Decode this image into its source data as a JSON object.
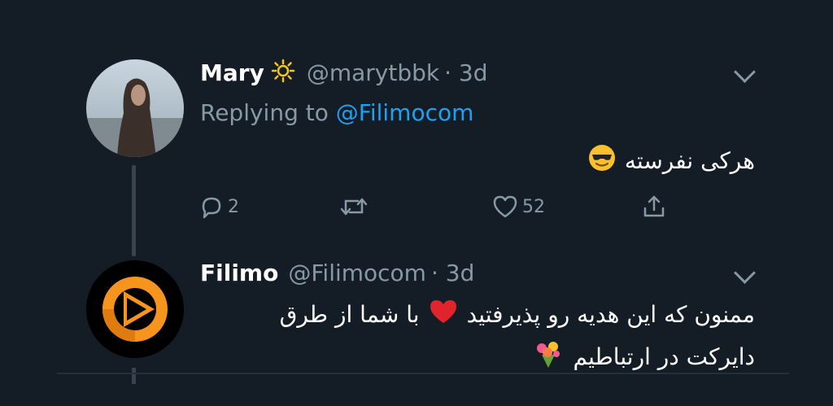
{
  "tweets": [
    {
      "name": "Mary",
      "name_emoji": "sun-icon",
      "handle": "@marytbbk",
      "time": "· 3d",
      "replying_prefix": "Replying to",
      "replying_to": "@Filimocom",
      "text": "هرکی نفرسته",
      "text_emoji": "sunglasses-face-icon",
      "actions": {
        "replies": "2",
        "retweets": "",
        "likes": "52"
      }
    },
    {
      "name": "Filimo",
      "handle": "@Filimocom",
      "time": "· 3d",
      "text_line1": "ممنون که این هدیه رو پذیرفتید",
      "text_line1_emoji": "red-heart-icon",
      "text_line1_end": "با شما از طرق",
      "text_line2": "دایرکت در ارتباطیم",
      "text_line2_emoji": "bouquet-icon"
    }
  ],
  "colors": {
    "background": "#141d26",
    "secondary_text": "#8899a6",
    "link": "#1da1f2",
    "brand_orange": "#f7941d"
  }
}
